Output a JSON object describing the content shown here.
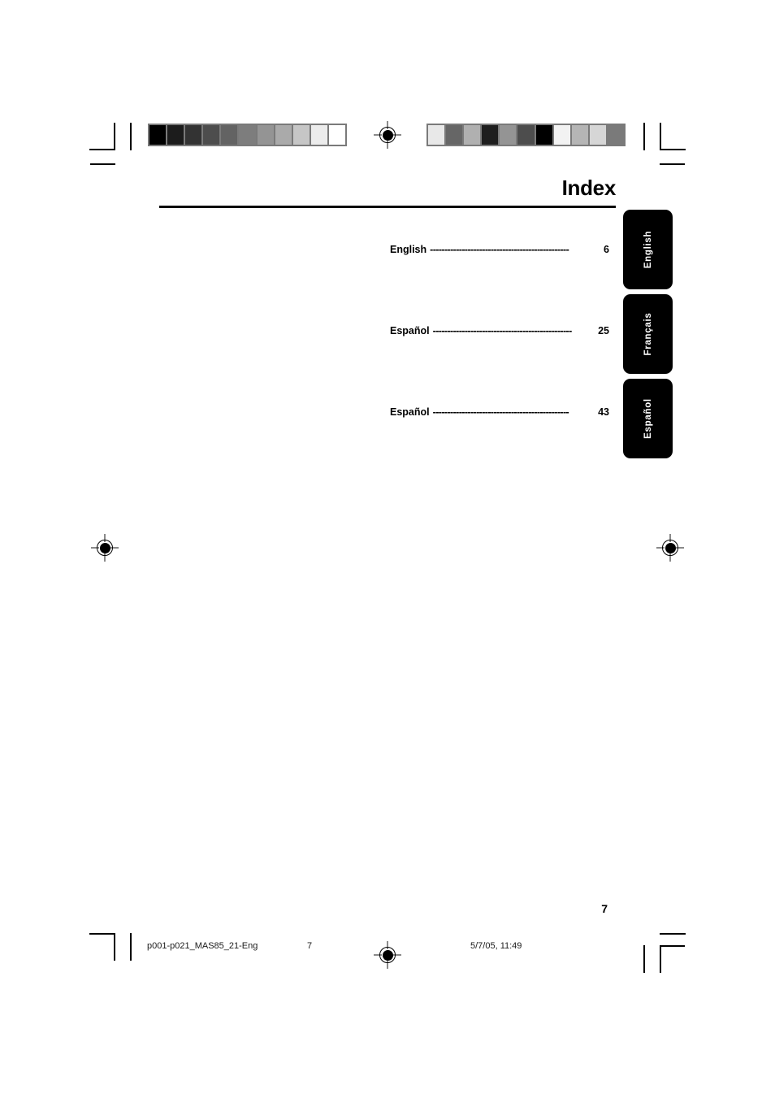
{
  "document": {
    "page_title": "Index",
    "page_number": "7"
  },
  "index": {
    "entries": [
      {
        "label": "English",
        "leader": "------------------------------------------------",
        "page": "6"
      },
      {
        "label": "Español",
        "leader": "------------------------------------------------",
        "page": "25"
      },
      {
        "label": "Español",
        "leader": "-----------------------------------------------",
        "page": "43"
      }
    ]
  },
  "side_tabs": [
    {
      "label": "English"
    },
    {
      "label": "Français"
    },
    {
      "label": "Español"
    }
  ],
  "footer": {
    "file_name": "p001-p021_MAS85_21-Eng",
    "page": "7",
    "date_time": "5/7/05, 11:49"
  },
  "print_marks": {
    "gray_strip_left": {
      "name": "grayscale-step-wedge",
      "swatches": [
        "#000000",
        "#1c1c1c",
        "#333333",
        "#4d4d4d",
        "#636363",
        "#7d7d7d",
        "#949494",
        "#aaaaaa",
        "#c6c6c6",
        "#ececec",
        "#ffffff"
      ]
    },
    "gray_strip_right": {
      "name": "grayscale-random-patches",
      "swatches": [
        "#e8e8e8",
        "#666666",
        "#b0b0b0",
        "#1e1e1e",
        "#949494",
        "#4d4d4d",
        "#000000",
        "#f2f2f2",
        "#b5b5b5",
        "#d6d6d6",
        "#7a7a7a"
      ]
    },
    "border_color": "#7a7a7a",
    "registration_color": "#000000"
  }
}
